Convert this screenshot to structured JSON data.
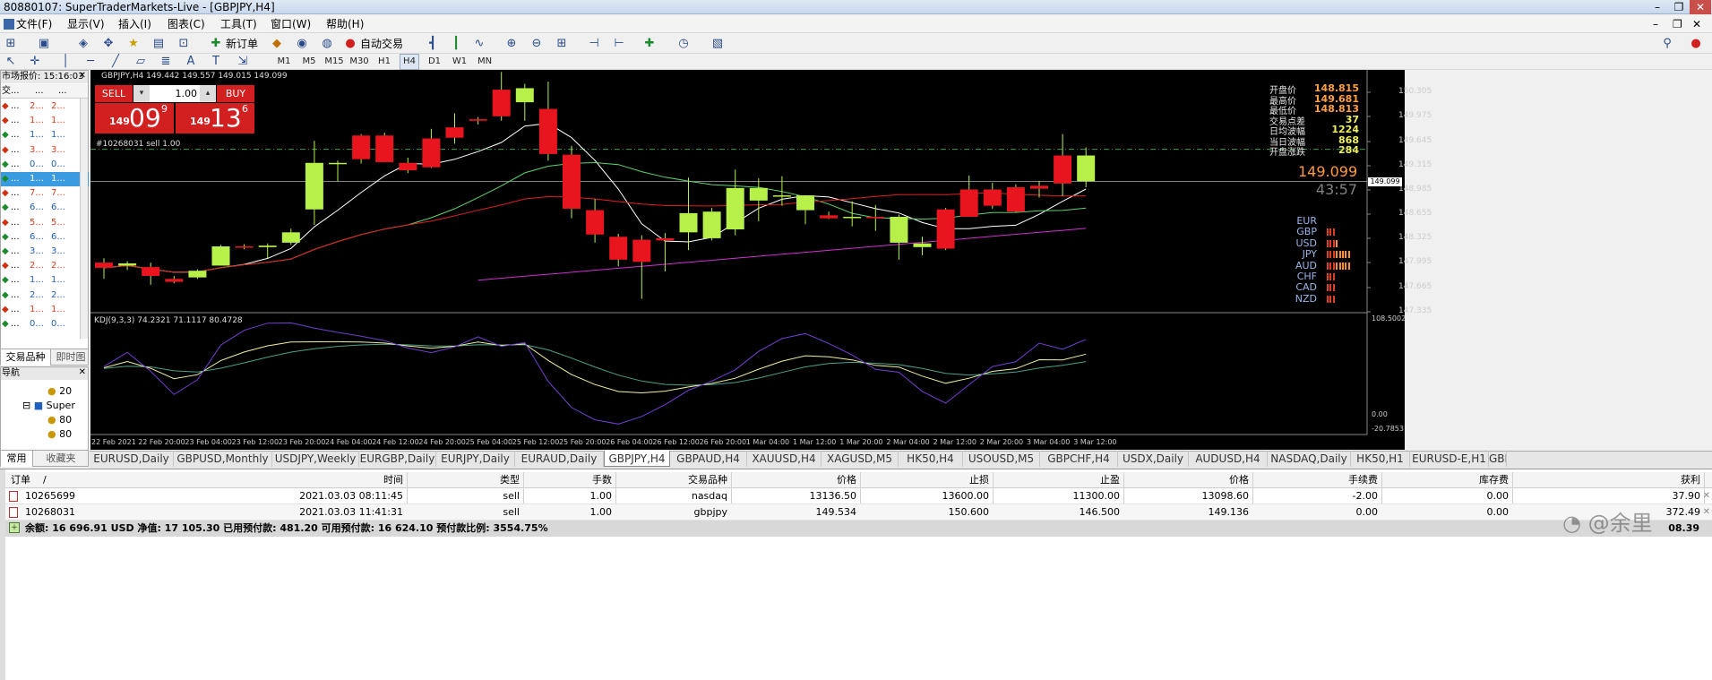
{
  "window": {
    "title": "80880107: SuperTraderMarkets-Live - [GBPJPY,H4]"
  },
  "menu": [
    "文件(F)",
    "显示(V)",
    "插入(I)",
    "图表(C)",
    "工具(T)",
    "窗口(W)",
    "帮助(H)"
  ],
  "toolbar": {
    "new_order": "新订单",
    "auto_trading": "自动交易",
    "text_tool": "A",
    "label_tool": "T"
  },
  "timeframes": [
    "M1",
    "M5",
    "M15",
    "M30",
    "H1",
    "H4",
    "D1",
    "W1",
    "MN"
  ],
  "active_timeframe": "H4",
  "market_watch": {
    "title": "市场报价: 15:16:03",
    "headers": [
      "交...",
      "...",
      "..."
    ],
    "rows": [
      {
        "a": "...",
        "b": "2...",
        "c": "2...",
        "color": "#e04020"
      },
      {
        "a": "...",
        "b": "1...",
        "c": "1...",
        "color": "#e04020"
      },
      {
        "a": "...",
        "b": "1...",
        "c": "1...",
        "color": "#2060c0"
      },
      {
        "a": "...",
        "b": "3...",
        "c": "3...",
        "color": "#e04020"
      },
      {
        "a": "...",
        "b": "0...",
        "c": "0...",
        "color": "#2060c0"
      },
      {
        "a": "...",
        "b": "1...",
        "c": "1...",
        "color": "#2060c0",
        "selected": true
      },
      {
        "a": "...",
        "b": "7...",
        "c": "7...",
        "color": "#e04020"
      },
      {
        "a": "...",
        "b": "6...",
        "c": "6...",
        "color": "#2060c0"
      },
      {
        "a": "...",
        "b": "5...",
        "c": "5...",
        "color": "#e04020"
      },
      {
        "a": "...",
        "b": "6...",
        "c": "6...",
        "color": "#2060c0"
      },
      {
        "a": "...",
        "b": "3...",
        "c": "3...",
        "color": "#2060c0"
      },
      {
        "a": "...",
        "b": "2...",
        "c": "2...",
        "color": "#e04020"
      },
      {
        "a": "...",
        "b": "1...",
        "c": "1...",
        "color": "#2060c0"
      },
      {
        "a": "...",
        "b": "2...",
        "c": "2...",
        "color": "#2060c0"
      },
      {
        "a": "...",
        "b": "1...",
        "c": "1...",
        "color": "#e04020"
      },
      {
        "a": "...",
        "b": "0...",
        "c": "0...",
        "color": "#2060c0"
      }
    ],
    "tabs": [
      "交易品种",
      "即时图"
    ]
  },
  "navigator": {
    "title": "导航",
    "items": [
      "20",
      "Super",
      "80",
      "80"
    ],
    "tabs": [
      "常用",
      "收藏夹"
    ]
  },
  "chart_header": {
    "symbol_info": "GBPJPY,H4  149.442 149.557 149.015 149.099",
    "sell_label": "SELL",
    "buy_label": "BUY",
    "lot_value": "1.00",
    "sell_price_small": "149",
    "sell_price_big": "09",
    "sell_price_sup": "9",
    "buy_price_small": "149",
    "buy_price_big": "13",
    "buy_price_sup": "6",
    "order_line_label": "#10268031 sell 1.00"
  },
  "info_panel": {
    "labels": [
      "开盘价",
      "最高价",
      "最低价",
      "交易点差",
      "日均波幅",
      "当日波幅",
      "开盘涨跌"
    ],
    "values": [
      "148.815",
      "149.681",
      "148.813",
      "37",
      "1224",
      "868",
      "284"
    ],
    "current_price": "149.099",
    "countdown": "43:57",
    "currencies": [
      "EUR",
      "GBP",
      "USD",
      "JPY",
      "AUD",
      "CHF",
      "CAD",
      "NZD"
    ],
    "currency_strength": [
      0,
      3,
      4,
      8,
      8,
      3,
      3,
      3
    ]
  },
  "price_axis": [
    "150.305",
    "149.975",
    "149.645",
    "149.315",
    "148.985",
    "148.655",
    "148.325",
    "147.995",
    "147.665",
    "147.335"
  ],
  "current_price_tag": "149.099",
  "indicator": {
    "label": "KDJ(9,3,3) 74.2321 71.1117 80.4728",
    "axis_top": "108.5002",
    "axis_mid": "0.00",
    "axis_bottom": "-20.7853"
  },
  "time_axis": [
    "22 Feb 2021",
    "22 Feb 20:00",
    "23 Feb 04:00",
    "23 Feb 12:00",
    "23 Feb 20:00",
    "24 Feb 04:00",
    "24 Feb 12:00",
    "24 Feb 20:00",
    "25 Feb 04:00",
    "25 Feb 12:00",
    "25 Feb 20:00",
    "26 Feb 04:00",
    "26 Feb 12:00",
    "26 Feb 20:00",
    "1 Mar 04:00",
    "1 Mar 12:00",
    "1 Mar 20:00",
    "2 Mar 04:00",
    "2 Mar 12:00",
    "2 Mar 20:00",
    "3 Mar 04:00",
    "3 Mar 12:00"
  ],
  "chart_tabs": [
    "EURUSD,Daily",
    "GBPUSD,Monthly",
    "USDJPY,Weekly",
    "EURGBP,Daily",
    "EURJPY,Daily",
    "EURAUD,Daily",
    "GBPJPY,H4",
    "GBPAUD,H4",
    "XAUUSD,H4",
    "XAGUSD,M5",
    "HK50,H4",
    "USOUSD,M5",
    "GBPCHF,H4",
    "USDX,Daily",
    "AUDUSD,H4",
    "NASDAQ,Daily",
    "HK50,H1",
    "EURUSD-E,H1",
    "GBP"
  ],
  "active_chart_tab": "GBPJPY,H4",
  "chart_data": {
    "type": "candlestick",
    "symbol": "GBPJPY",
    "timeframe": "H4",
    "candles": [
      [
        148.0,
        148.06,
        147.78,
        147.93
      ],
      [
        147.96,
        148.02,
        147.9,
        147.99
      ],
      [
        147.94,
        148.0,
        147.7,
        147.82
      ],
      [
        147.78,
        147.82,
        147.72,
        147.74
      ],
      [
        147.8,
        147.91,
        147.78,
        147.89
      ],
      [
        147.96,
        148.24,
        147.96,
        148.22
      ],
      [
        148.22,
        148.25,
        148.18,
        148.21
      ],
      [
        148.21,
        148.26,
        148.06,
        148.23
      ],
      [
        148.27,
        148.46,
        148.24,
        148.41
      ],
      [
        148.72,
        149.65,
        148.51,
        149.35
      ],
      [
        149.34,
        149.38,
        149.1,
        149.35
      ],
      [
        149.72,
        149.74,
        149.34,
        149.4
      ],
      [
        149.72,
        149.76,
        149.37,
        149.36
      ],
      [
        149.35,
        149.42,
        149.21,
        149.25
      ],
      [
        149.68,
        149.81,
        149.28,
        149.29
      ],
      [
        149.83,
        150.02,
        149.61,
        149.69
      ],
      [
        149.94,
        149.97,
        149.87,
        149.92
      ],
      [
        150.34,
        150.58,
        149.92,
        149.98
      ],
      [
        150.17,
        150.42,
        149.92,
        150.36
      ],
      [
        150.08,
        150.45,
        149.38,
        149.47
      ],
      [
        149.46,
        149.58,
        148.6,
        148.73
      ],
      [
        148.71,
        148.86,
        148.27,
        148.38
      ],
      [
        148.35,
        148.39,
        147.95,
        148.04
      ],
      [
        148.31,
        148.37,
        147.51,
        148.01
      ],
      [
        148.33,
        148.4,
        147.88,
        148.3
      ],
      [
        148.41,
        149.15,
        148.17,
        148.67
      ],
      [
        148.33,
        148.74,
        148.3,
        148.69
      ],
      [
        148.45,
        149.26,
        148.37,
        149.01
      ],
      [
        148.84,
        149.14,
        148.56,
        149.01
      ],
      [
        148.91,
        149.17,
        148.77,
        148.91
      ],
      [
        148.71,
        148.9,
        148.52,
        148.91
      ],
      [
        148.64,
        148.69,
        148.59,
        148.6
      ],
      [
        148.61,
        148.83,
        148.49,
        148.62
      ],
      [
        148.62,
        148.78,
        148.43,
        148.61
      ],
      [
        148.27,
        148.65,
        148.04,
        148.62
      ],
      [
        148.21,
        148.35,
        148.1,
        148.26
      ],
      [
        148.72,
        148.74,
        148.17,
        148.19
      ],
      [
        148.99,
        149.18,
        148.62,
        148.62
      ],
      [
        148.99,
        149.08,
        148.73,
        148.77
      ],
      [
        149.02,
        149.06,
        148.68,
        148.69
      ],
      [
        149.04,
        149.1,
        148.88,
        149.0
      ],
      [
        149.45,
        149.74,
        148.9,
        149.07
      ],
      [
        149.1,
        149.56,
        149.02,
        149.45
      ]
    ],
    "ylim": [
      147.335,
      150.5
    ],
    "kdj": {
      "k": 74.2321,
      "d": 71.1117,
      "j": 80.4728
    },
    "kdj_ylim": [
      -20.7853,
      108.5002
    ],
    "colors": {
      "bull": "#b8f04a",
      "bear": "#e8141e",
      "wick": "#b8f04a"
    }
  },
  "trade_table": {
    "headers": [
      "订单",
      "/",
      "时间",
      "类型",
      "手数",
      "交易品种",
      "价格",
      "止损",
      "止盈",
      "价格",
      "手续费",
      "库存费",
      "获利"
    ],
    "rows": [
      [
        "10265699",
        "2021.03.03 08:11:45",
        "sell",
        "1.00",
        "nasdaq",
        "13136.50",
        "13600.00",
        "11300.00",
        "13098.60",
        "-2.00",
        "0.00",
        "37.90"
      ],
      [
        "10268031",
        "2021.03.03 11:41:31",
        "sell",
        "1.00",
        "gbpjpy",
        "149.534",
        "150.600",
        "146.500",
        "149.136",
        "0.00",
        "0.00",
        "372.49"
      ]
    ],
    "summary": "余额: 16 696.91 USD  净值: 17 105.30  已用预付款: 481.20  可用预付款: 16 624.10  预付款比例: 3554.75%",
    "summary_profit": "08.39"
  },
  "watermark": "@余里"
}
